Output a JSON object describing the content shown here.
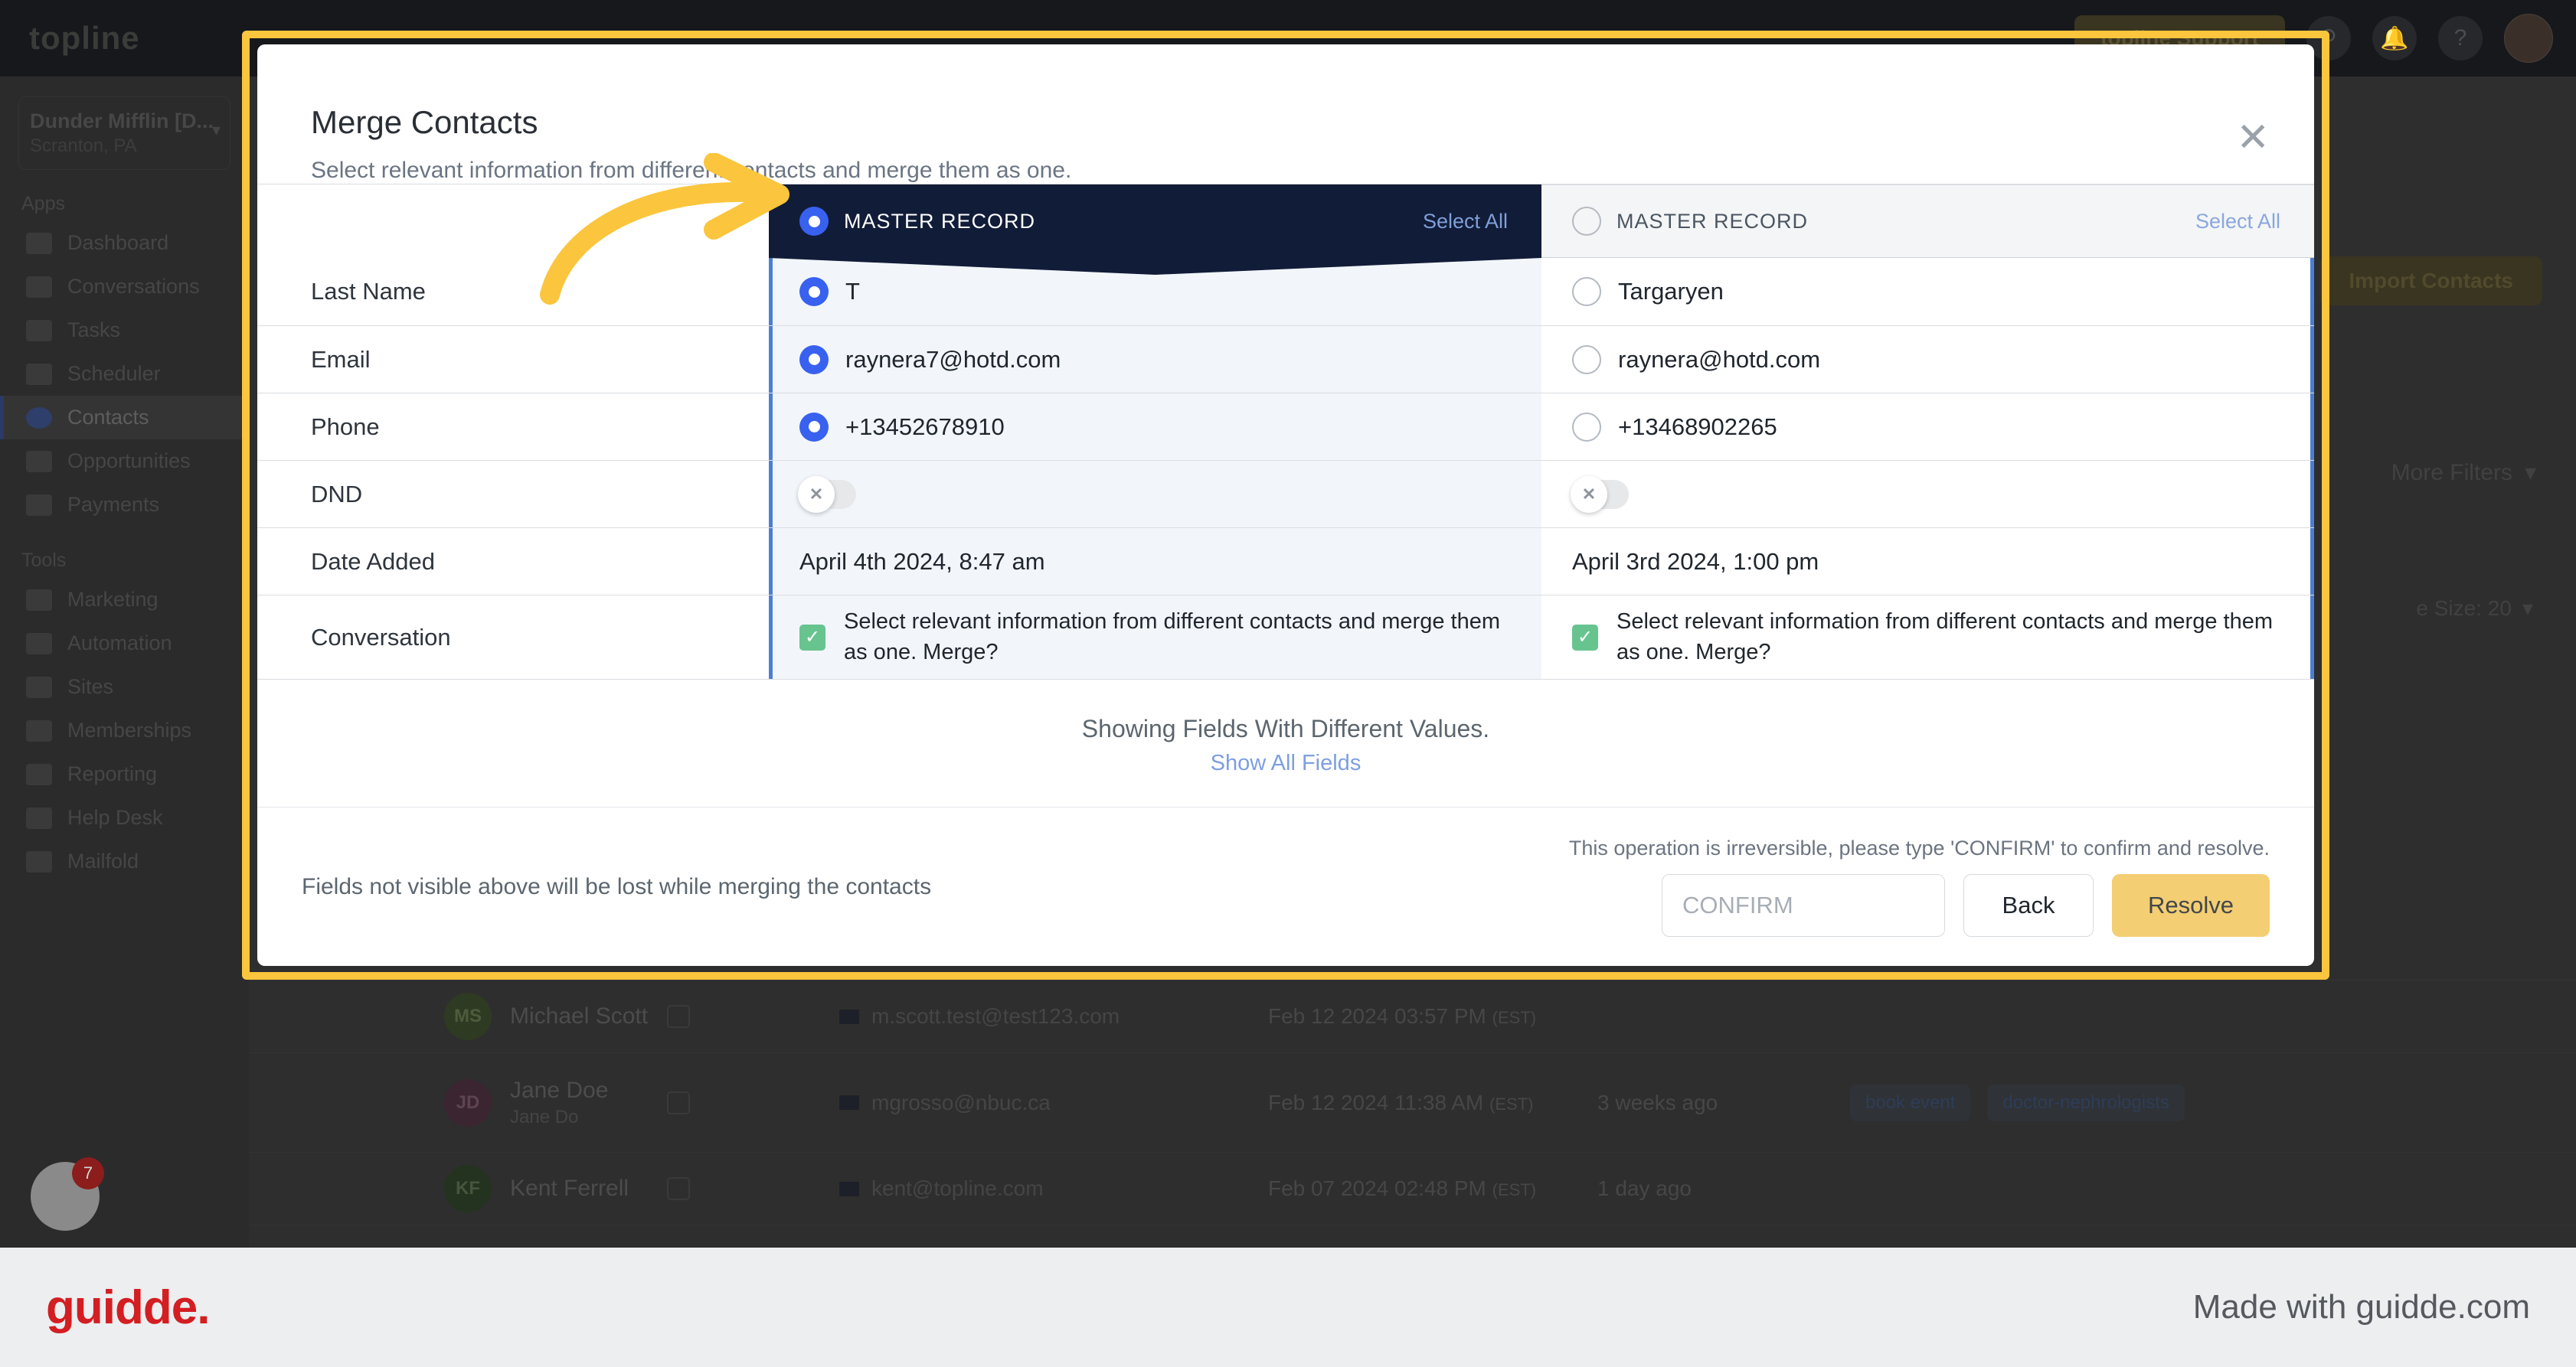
{
  "background": {
    "logo": "topline",
    "support_button": "topline Support",
    "icons": {
      "search": "search-icon",
      "bell": "bell-icon",
      "help": "help-icon"
    },
    "account": {
      "name": "Dunder Mifflin [D...",
      "location": "Scranton, PA"
    },
    "sidebar": {
      "sections": [
        {
          "title": "Apps",
          "items": [
            "Dashboard",
            "Conversations",
            "Tasks",
            "Scheduler",
            "Contacts",
            "Opportunities",
            "Payments"
          ]
        },
        {
          "title": "Tools",
          "items": [
            "Marketing",
            "Automation",
            "Sites",
            "Memberships",
            "Reporting",
            "Help Desk",
            "Mailfold"
          ]
        }
      ],
      "active_item": "Contacts",
      "chat_badge": "7"
    },
    "import_button": "Import Contacts",
    "more_filters": "More Filters",
    "page_size": "e Size: 20",
    "contacts": [
      {
        "initials": "MS",
        "avatar_color": "#2f3a22",
        "name": "Michael Scott",
        "sub": "",
        "email": "m.scott.test@test123.com",
        "date": "Feb 12 2024 03:57 PM",
        "tz": "(EST)",
        "ago": "",
        "tags": []
      },
      {
        "initials": "JD",
        "avatar_color": "#3a2530",
        "name": "Jane Doe",
        "sub": "Jane Do",
        "email": "mgrosso@nbuc.ca",
        "date": "Feb 12 2024 11:38 AM",
        "tz": "(EST)",
        "ago": "3 weeks ago",
        "tags": [
          "book event",
          "doctor-nephrologists"
        ]
      },
      {
        "initials": "KF",
        "avatar_color": "#24331f",
        "name": "Kent Ferrell",
        "sub": "",
        "email": "kent@topline.com",
        "date": "Feb 07 2024 02:48 PM",
        "tz": "(EST)",
        "ago": "1 day ago",
        "tags": []
      }
    ]
  },
  "modal": {
    "title": "Merge Contacts",
    "subtitle": "Select relevant information from different contacts and merge them as one.",
    "close_icon": "close-icon",
    "columns": [
      {
        "header": "MASTER RECORD",
        "select_all": "Select All",
        "selected": true
      },
      {
        "header": "MASTER RECORD",
        "select_all": "Select All",
        "selected": false
      }
    ],
    "rows": [
      {
        "label": "Last Name",
        "type": "radio",
        "left": "T",
        "right": "Targaryen"
      },
      {
        "label": "Email",
        "type": "radio",
        "left": "raynera7@hotd.com",
        "right": "raynera@hotd.com"
      },
      {
        "label": "Phone",
        "type": "radio",
        "left": "+13452678910",
        "right": "+13468902265"
      },
      {
        "label": "DND",
        "type": "toggle",
        "left": "off",
        "right": "off"
      },
      {
        "label": "Date Added",
        "type": "text",
        "left": "April 4th 2024, 8:47 am",
        "right": "April 3rd 2024, 1:00 pm"
      },
      {
        "label": "Conversation",
        "type": "checkbox",
        "left": "Select relevant information from different contacts and merge them as one. Merge?",
        "right": "Select relevant information from different contacts and merge them as one. Merge?"
      }
    ],
    "showing_fields": "Showing Fields With Different Values.",
    "show_all_fields": "Show All Fields",
    "footer_warning": "Fields not visible above will be lost while merging the contacts",
    "footer_note": "This operation is irreversible, please type 'CONFIRM' to confirm and resolve.",
    "confirm_placeholder": "CONFIRM",
    "confirm_value": "",
    "back_label": "Back",
    "resolve_label": "Resolve"
  },
  "brand": {
    "logo": "guidde.",
    "made_with": "Made with guidde.com"
  },
  "colors": {
    "accent_yellow": "#fbc53d",
    "master_dark": "#111c38",
    "radio_blue": "#3861f0",
    "resolve": "#f3ce72",
    "brand_red": "#d31e22"
  }
}
